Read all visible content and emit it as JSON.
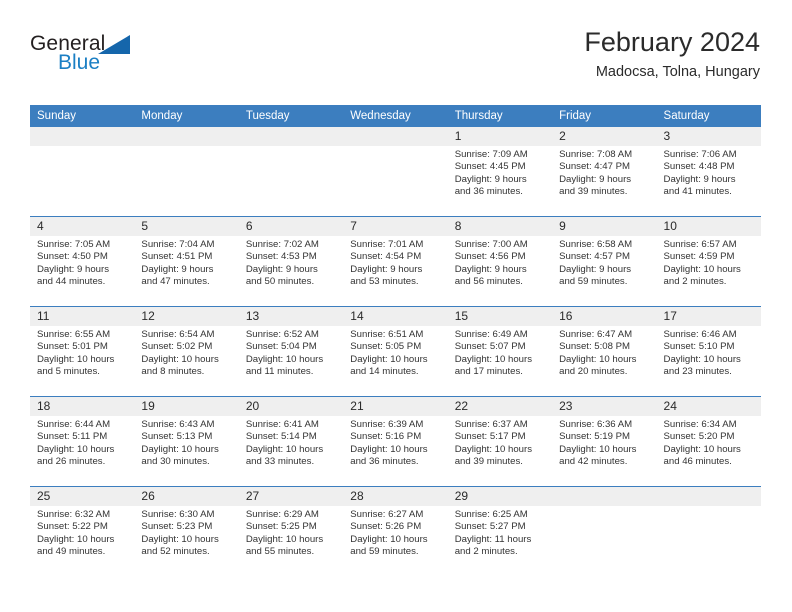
{
  "brand": {
    "name_part1": "General",
    "name_part2": "Blue",
    "logo_icon": "triangle-logo-icon"
  },
  "header": {
    "title": "February 2024",
    "location": "Madocsa, Tolna, Hungary"
  },
  "colors": {
    "header_blue": "#3c7ebf",
    "brand_blue": "#1b7fc4",
    "daynum_bg": "#efefef",
    "text": "#333333"
  },
  "calendar": {
    "weekday_headers": [
      "Sunday",
      "Monday",
      "Tuesday",
      "Wednesday",
      "Thursday",
      "Friday",
      "Saturday"
    ],
    "weeks": [
      [
        {
          "day": "",
          "sunrise": "",
          "sunset": "",
          "daylight1": "",
          "daylight2": ""
        },
        {
          "day": "",
          "sunrise": "",
          "sunset": "",
          "daylight1": "",
          "daylight2": ""
        },
        {
          "day": "",
          "sunrise": "",
          "sunset": "",
          "daylight1": "",
          "daylight2": ""
        },
        {
          "day": "",
          "sunrise": "",
          "sunset": "",
          "daylight1": "",
          "daylight2": ""
        },
        {
          "day": "1",
          "sunrise": "Sunrise: 7:09 AM",
          "sunset": "Sunset: 4:45 PM",
          "daylight1": "Daylight: 9 hours",
          "daylight2": "and 36 minutes."
        },
        {
          "day": "2",
          "sunrise": "Sunrise: 7:08 AM",
          "sunset": "Sunset: 4:47 PM",
          "daylight1": "Daylight: 9 hours",
          "daylight2": "and 39 minutes."
        },
        {
          "day": "3",
          "sunrise": "Sunrise: 7:06 AM",
          "sunset": "Sunset: 4:48 PM",
          "daylight1": "Daylight: 9 hours",
          "daylight2": "and 41 minutes."
        }
      ],
      [
        {
          "day": "4",
          "sunrise": "Sunrise: 7:05 AM",
          "sunset": "Sunset: 4:50 PM",
          "daylight1": "Daylight: 9 hours",
          "daylight2": "and 44 minutes."
        },
        {
          "day": "5",
          "sunrise": "Sunrise: 7:04 AM",
          "sunset": "Sunset: 4:51 PM",
          "daylight1": "Daylight: 9 hours",
          "daylight2": "and 47 minutes."
        },
        {
          "day": "6",
          "sunrise": "Sunrise: 7:02 AM",
          "sunset": "Sunset: 4:53 PM",
          "daylight1": "Daylight: 9 hours",
          "daylight2": "and 50 minutes."
        },
        {
          "day": "7",
          "sunrise": "Sunrise: 7:01 AM",
          "sunset": "Sunset: 4:54 PM",
          "daylight1": "Daylight: 9 hours",
          "daylight2": "and 53 minutes."
        },
        {
          "day": "8",
          "sunrise": "Sunrise: 7:00 AM",
          "sunset": "Sunset: 4:56 PM",
          "daylight1": "Daylight: 9 hours",
          "daylight2": "and 56 minutes."
        },
        {
          "day": "9",
          "sunrise": "Sunrise: 6:58 AM",
          "sunset": "Sunset: 4:57 PM",
          "daylight1": "Daylight: 9 hours",
          "daylight2": "and 59 minutes."
        },
        {
          "day": "10",
          "sunrise": "Sunrise: 6:57 AM",
          "sunset": "Sunset: 4:59 PM",
          "daylight1": "Daylight: 10 hours",
          "daylight2": "and 2 minutes."
        }
      ],
      [
        {
          "day": "11",
          "sunrise": "Sunrise: 6:55 AM",
          "sunset": "Sunset: 5:01 PM",
          "daylight1": "Daylight: 10 hours",
          "daylight2": "and 5 minutes."
        },
        {
          "day": "12",
          "sunrise": "Sunrise: 6:54 AM",
          "sunset": "Sunset: 5:02 PM",
          "daylight1": "Daylight: 10 hours",
          "daylight2": "and 8 minutes."
        },
        {
          "day": "13",
          "sunrise": "Sunrise: 6:52 AM",
          "sunset": "Sunset: 5:04 PM",
          "daylight1": "Daylight: 10 hours",
          "daylight2": "and 11 minutes."
        },
        {
          "day": "14",
          "sunrise": "Sunrise: 6:51 AM",
          "sunset": "Sunset: 5:05 PM",
          "daylight1": "Daylight: 10 hours",
          "daylight2": "and 14 minutes."
        },
        {
          "day": "15",
          "sunrise": "Sunrise: 6:49 AM",
          "sunset": "Sunset: 5:07 PM",
          "daylight1": "Daylight: 10 hours",
          "daylight2": "and 17 minutes."
        },
        {
          "day": "16",
          "sunrise": "Sunrise: 6:47 AM",
          "sunset": "Sunset: 5:08 PM",
          "daylight1": "Daylight: 10 hours",
          "daylight2": "and 20 minutes."
        },
        {
          "day": "17",
          "sunrise": "Sunrise: 6:46 AM",
          "sunset": "Sunset: 5:10 PM",
          "daylight1": "Daylight: 10 hours",
          "daylight2": "and 23 minutes."
        }
      ],
      [
        {
          "day": "18",
          "sunrise": "Sunrise: 6:44 AM",
          "sunset": "Sunset: 5:11 PM",
          "daylight1": "Daylight: 10 hours",
          "daylight2": "and 26 minutes."
        },
        {
          "day": "19",
          "sunrise": "Sunrise: 6:43 AM",
          "sunset": "Sunset: 5:13 PM",
          "daylight1": "Daylight: 10 hours",
          "daylight2": "and 30 minutes."
        },
        {
          "day": "20",
          "sunrise": "Sunrise: 6:41 AM",
          "sunset": "Sunset: 5:14 PM",
          "daylight1": "Daylight: 10 hours",
          "daylight2": "and 33 minutes."
        },
        {
          "day": "21",
          "sunrise": "Sunrise: 6:39 AM",
          "sunset": "Sunset: 5:16 PM",
          "daylight1": "Daylight: 10 hours",
          "daylight2": "and 36 minutes."
        },
        {
          "day": "22",
          "sunrise": "Sunrise: 6:37 AM",
          "sunset": "Sunset: 5:17 PM",
          "daylight1": "Daylight: 10 hours",
          "daylight2": "and 39 minutes."
        },
        {
          "day": "23",
          "sunrise": "Sunrise: 6:36 AM",
          "sunset": "Sunset: 5:19 PM",
          "daylight1": "Daylight: 10 hours",
          "daylight2": "and 42 minutes."
        },
        {
          "day": "24",
          "sunrise": "Sunrise: 6:34 AM",
          "sunset": "Sunset: 5:20 PM",
          "daylight1": "Daylight: 10 hours",
          "daylight2": "and 46 minutes."
        }
      ],
      [
        {
          "day": "25",
          "sunrise": "Sunrise: 6:32 AM",
          "sunset": "Sunset: 5:22 PM",
          "daylight1": "Daylight: 10 hours",
          "daylight2": "and 49 minutes."
        },
        {
          "day": "26",
          "sunrise": "Sunrise: 6:30 AM",
          "sunset": "Sunset: 5:23 PM",
          "daylight1": "Daylight: 10 hours",
          "daylight2": "and 52 minutes."
        },
        {
          "day": "27",
          "sunrise": "Sunrise: 6:29 AM",
          "sunset": "Sunset: 5:25 PM",
          "daylight1": "Daylight: 10 hours",
          "daylight2": "and 55 minutes."
        },
        {
          "day": "28",
          "sunrise": "Sunrise: 6:27 AM",
          "sunset": "Sunset: 5:26 PM",
          "daylight1": "Daylight: 10 hours",
          "daylight2": "and 59 minutes."
        },
        {
          "day": "29",
          "sunrise": "Sunrise: 6:25 AM",
          "sunset": "Sunset: 5:27 PM",
          "daylight1": "Daylight: 11 hours",
          "daylight2": "and 2 minutes."
        },
        {
          "day": "",
          "sunrise": "",
          "sunset": "",
          "daylight1": "",
          "daylight2": ""
        },
        {
          "day": "",
          "sunrise": "",
          "sunset": "",
          "daylight1": "",
          "daylight2": ""
        }
      ]
    ]
  }
}
